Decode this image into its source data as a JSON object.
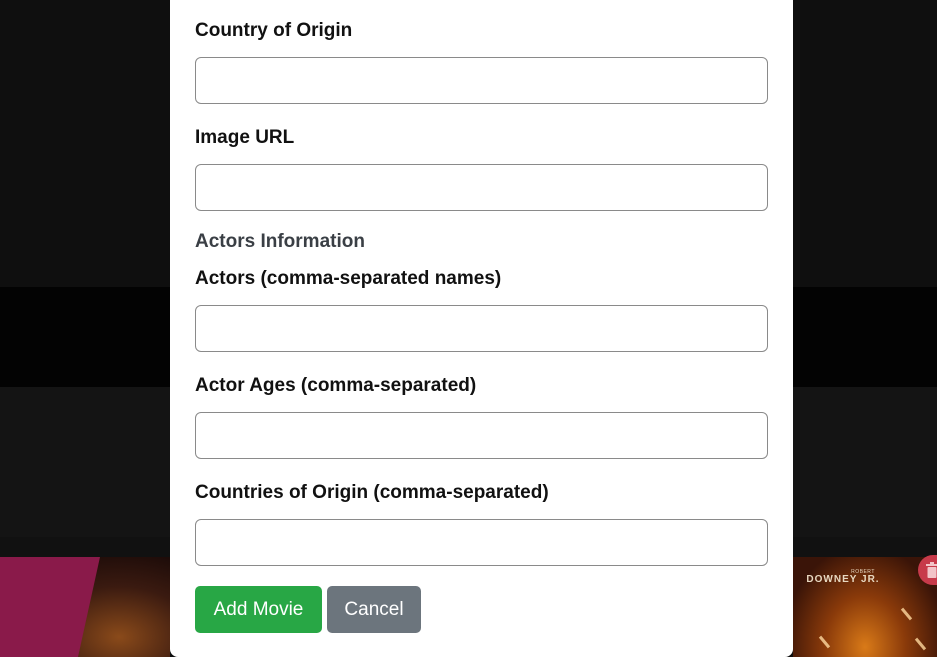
{
  "background": {
    "poster_credit_small": "ROBERT",
    "poster_credit_name": "DOWNEY JR."
  },
  "form": {
    "country_label": "Country of Origin",
    "country_value": "",
    "image_url_label": "Image URL",
    "image_url_value": "",
    "actors_section_heading": "Actors Information",
    "actors_label": "Actors (comma-separated names)",
    "actors_value": "",
    "actor_ages_label": "Actor Ages (comma-separated)",
    "actor_ages_value": "",
    "actor_countries_label": "Countries of Origin (comma-separated)",
    "actor_countries_value": "",
    "add_button_label": "Add Movie",
    "cancel_button_label": "Cancel"
  },
  "colors": {
    "add_button": "#28a745",
    "cancel_button": "#6c757d",
    "delete_button": "#c73a4a",
    "modal_background": "#ffffff",
    "page_background": "#0f0f0f"
  },
  "icons": {
    "delete": "trash-icon"
  }
}
